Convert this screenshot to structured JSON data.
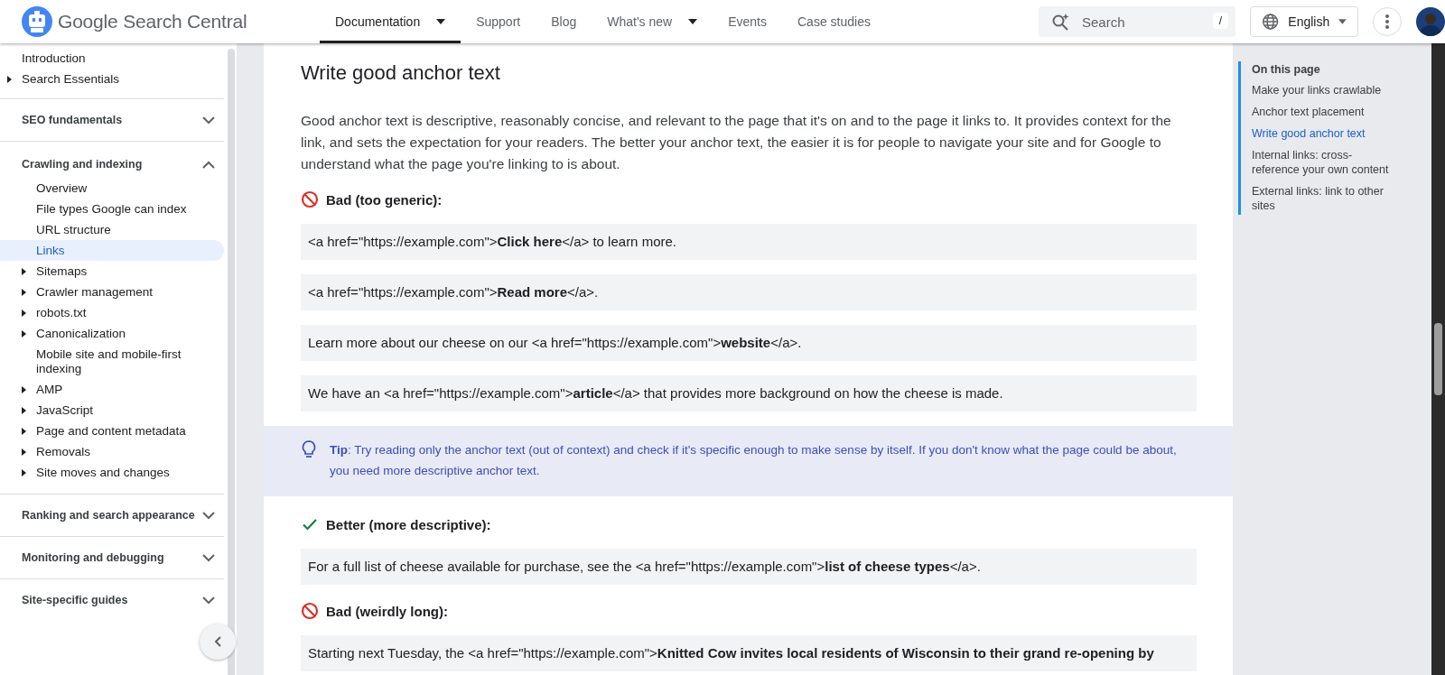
{
  "header": {
    "logo_text": "Google Search Central",
    "nav": [
      {
        "label": "Documentation",
        "selected": true,
        "dropdown": true
      },
      {
        "label": "Support",
        "selected": false,
        "dropdown": false
      },
      {
        "label": "Blog",
        "selected": false,
        "dropdown": false
      },
      {
        "label": "What's new",
        "selected": false,
        "dropdown": true
      },
      {
        "label": "Events",
        "selected": false,
        "dropdown": false
      },
      {
        "label": "Case studies",
        "selected": false,
        "dropdown": false
      }
    ],
    "search": {
      "placeholder": "Search",
      "shortcut": "/"
    },
    "language": "English"
  },
  "sidebar": {
    "top": [
      {
        "label": "Introduction",
        "expandable": false
      },
      {
        "label": "Search Essentials",
        "expandable": true
      }
    ],
    "sections": [
      {
        "label": "SEO fundamentals",
        "expanded": false
      },
      {
        "label": "Crawling and indexing",
        "expanded": true,
        "children": [
          {
            "label": "Overview",
            "expandable": false,
            "selected": false
          },
          {
            "label": "File types Google can index",
            "expandable": false,
            "selected": false
          },
          {
            "label": "URL structure",
            "expandable": false,
            "selected": false
          },
          {
            "label": "Links",
            "expandable": false,
            "selected": true
          },
          {
            "label": "Sitemaps",
            "expandable": true,
            "selected": false
          },
          {
            "label": "Crawler management",
            "expandable": true,
            "selected": false
          },
          {
            "label": "robots.txt",
            "expandable": true,
            "selected": false
          },
          {
            "label": "Canonicalization",
            "expandable": true,
            "selected": false
          },
          {
            "label": "Mobile site and mobile-first indexing",
            "expandable": false,
            "selected": false
          },
          {
            "label": "AMP",
            "expandable": true,
            "selected": false
          },
          {
            "label": "JavaScript",
            "expandable": true,
            "selected": false
          },
          {
            "label": "Page and content metadata",
            "expandable": true,
            "selected": false
          },
          {
            "label": "Removals",
            "expandable": true,
            "selected": false
          },
          {
            "label": "Site moves and changes",
            "expandable": true,
            "selected": false
          }
        ]
      },
      {
        "label": "Ranking and search appearance",
        "expanded": false
      },
      {
        "label": "Monitoring and debugging",
        "expanded": false
      },
      {
        "label": "Site-specific guides",
        "expanded": false
      }
    ]
  },
  "content": {
    "heading": "Write good anchor text",
    "paragraph": "Good anchor text is descriptive, reasonably concise, and relevant to the page that it's on and to the page it links to. It provides context for the link, and sets the expectation for your readers. The better your anchor text, the easier it is for people to navigate your site and for Google to understand what the page you're linking to is about.",
    "blocks": [
      {
        "kind": "bad",
        "text": "Bad (too generic):"
      },
      {
        "kind": "code",
        "text": "<a href=\"https://example.com\">**Click here**</a> to learn more."
      },
      {
        "kind": "code",
        "text": "<a href=\"https://example.com\">**Read more**</a>."
      },
      {
        "kind": "code",
        "text": "Learn more about our cheese on our <a href=\"https://example.com\">**website**</a>."
      },
      {
        "kind": "code",
        "text": "We have an <a href=\"https://example.com\">**article**</a> that provides more background on how the cheese is made."
      },
      {
        "kind": "tip",
        "text": "**Tip**: Try reading only the anchor text (out of context) and check if it's specific enough to make sense by itself. If you don't know what the page could be about, you need more descriptive anchor text."
      },
      {
        "kind": "good",
        "text": "Better (more descriptive):"
      },
      {
        "kind": "code",
        "text": "For a full list of cheese available for purchase, see the <a href=\"https://example.com\">**list of cheese types**</a>."
      },
      {
        "kind": "bad",
        "text": "Bad (weirdly long):"
      },
      {
        "kind": "code",
        "text": "Starting next Tuesday, the <a href=\"https://example.com\">**Knitted Cow invites local residents of Wisconsin to their grand re-opening by**"
      }
    ]
  },
  "toc": {
    "title": "On this page",
    "items": [
      {
        "label": "Make your links crawlable",
        "selected": false
      },
      {
        "label": "Anchor text placement",
        "selected": false
      },
      {
        "label": "Write good anchor text",
        "selected": true
      },
      {
        "label": "Internal links: cross-reference your own content",
        "selected": false
      },
      {
        "label": "External links: link to other sites",
        "selected": false
      }
    ]
  }
}
